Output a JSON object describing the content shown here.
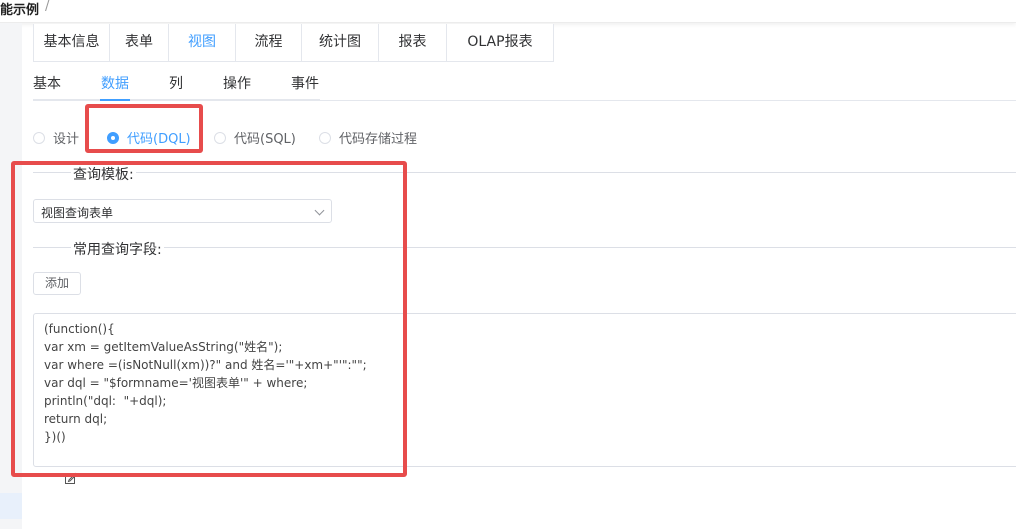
{
  "breadcrumb": {
    "title": "能示例",
    "separator": "/"
  },
  "top_tabs": [
    "基本信息",
    "表单",
    "视图",
    "流程",
    "统计图",
    "报表",
    "OLAP报表"
  ],
  "top_tab_active": "视图",
  "sub_tabs": [
    "基本",
    "数据",
    "列",
    "操作",
    "事件"
  ],
  "sub_tab_active": "数据",
  "data_source_options": [
    {
      "label": "设计",
      "checked": false
    },
    {
      "label": "代码(DQL)",
      "checked": true
    },
    {
      "label": "代码(SQL)",
      "checked": false
    },
    {
      "label": "代码存储过程",
      "checked": false
    }
  ],
  "query_template": {
    "heading": "查询模板:",
    "selected": "视图查询表单"
  },
  "common_fields": {
    "heading": "常用查询字段:",
    "add_label": "添加"
  },
  "code_lines": [
    "(function(){",
    "var xm = getItemValueAsString(\"姓名\");",
    "var where =(isNotNull(xm))?\" and 姓名='\"+xm+\"'\":\"\";",
    "var dql = \"$formname='视图表单'\" + where;",
    "println(\"dql:  \"+dql);",
    "return dql;",
    "})()"
  ],
  "colors": {
    "accent": "#409eff",
    "highlight_box": "#e74c4c",
    "border": "#dcdfe6"
  },
  "icons": {
    "edit": "edit-icon",
    "chevron": "chevron-down-icon"
  }
}
